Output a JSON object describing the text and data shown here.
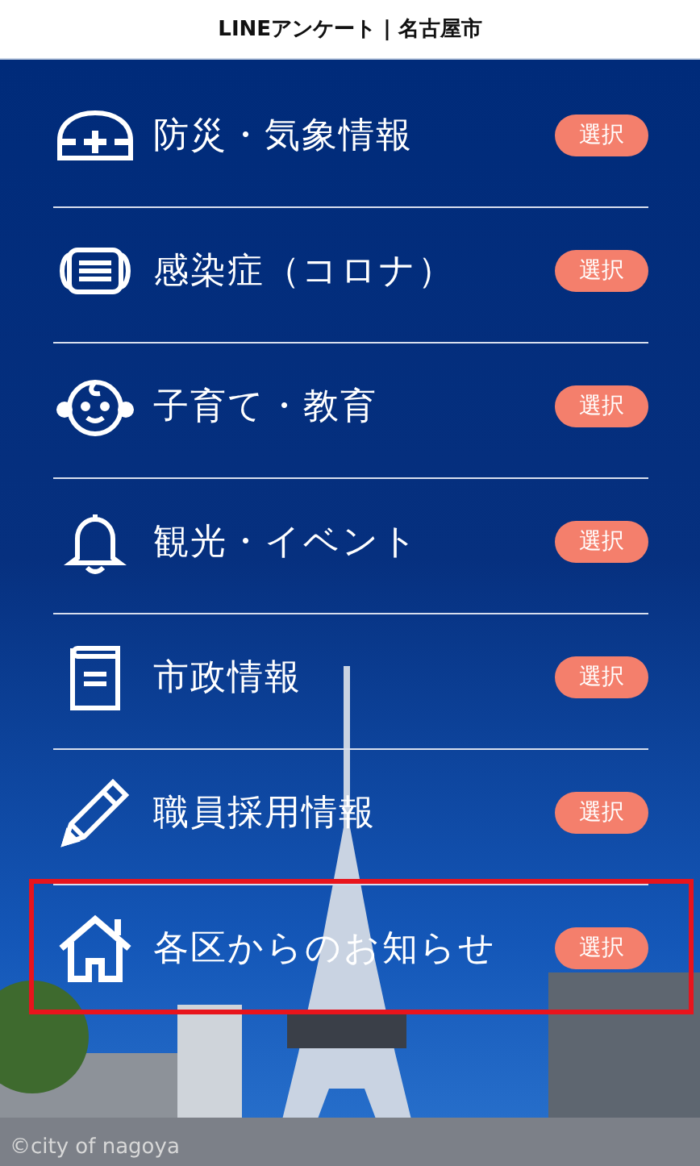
{
  "header": {
    "title": "LINEアンケート | 名古屋市"
  },
  "items": [
    {
      "label": "防災・気象情報",
      "button": "選択",
      "selected": false
    },
    {
      "label": "感染症（コロナ）",
      "button": "選択",
      "selected": false
    },
    {
      "label": "子育て・教育",
      "button": "選択",
      "selected": false
    },
    {
      "label": "観光・イベント",
      "button": "選択",
      "selected": false
    },
    {
      "label": "市政情報",
      "button": "選択",
      "selected": false
    },
    {
      "label": "職員採用情報",
      "button": "選択",
      "selected": false
    },
    {
      "label": "各区からのお知らせ",
      "button": "選択",
      "selected": true
    }
  ],
  "photo_credit": "©city of nagoya"
}
